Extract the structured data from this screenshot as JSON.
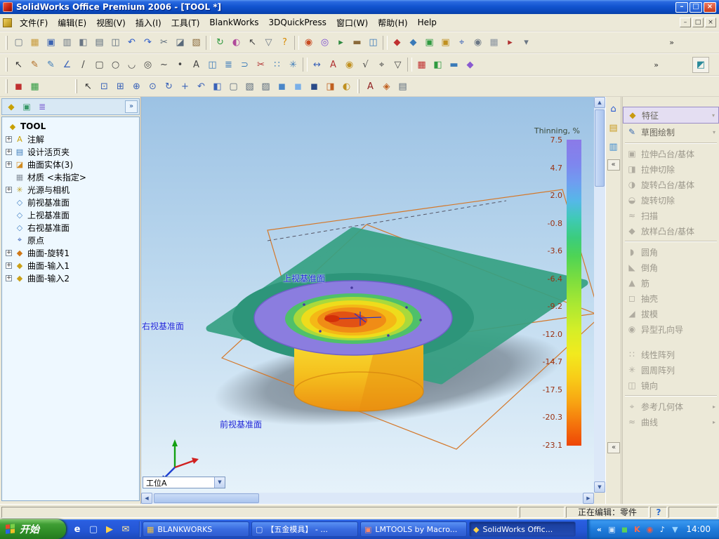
{
  "window": {
    "title": "SolidWorks Office Premium 2006 - [TOOL *]"
  },
  "glyphs": {
    "minimize": "–",
    "maximize": "□",
    "close": "×",
    "overflow": "»",
    "collapse": "«",
    "dropdown": "▼",
    "scroll_up": "▲",
    "scroll_down": "▼",
    "scroll_left": "◀",
    "scroll_right": "▶",
    "expand": "»"
  },
  "menu": {
    "items": [
      "文件(F)",
      "编辑(E)",
      "视图(V)",
      "插入(I)",
      "工具(T)",
      "BlankWorks",
      "3DQuickPress",
      "窗口(W)",
      "帮助(H)",
      "Help"
    ]
  },
  "toolbars": {
    "standard": [
      {
        "n": "new-document-icon",
        "g": "▢",
        "c": "#6a7684"
      },
      {
        "n": "open-icon",
        "g": "▦",
        "c": "#c89a3a"
      },
      {
        "n": "save-icon",
        "g": "▣",
        "c": "#3a62b0"
      },
      {
        "n": "make-drawing-icon",
        "g": "▥",
        "c": "#6a7684"
      },
      {
        "n": "make-assembly-icon",
        "g": "◧",
        "c": "#6a7684"
      },
      {
        "n": "print-icon",
        "g": "▤",
        "c": "#5a6a7a"
      },
      {
        "n": "print-preview-icon",
        "g": "◫",
        "c": "#5a6a7a"
      },
      {
        "n": "undo-icon",
        "g": "↶",
        "c": "#2a5ac8"
      },
      {
        "n": "redo-icon",
        "g": "↷",
        "c": "#2a5ac8"
      },
      {
        "n": "cut-icon",
        "g": "✂",
        "c": "#5a6a7a"
      },
      {
        "n": "copy-icon",
        "g": "◪",
        "c": "#5a6a7a"
      },
      {
        "n": "paste-icon",
        "g": "▧",
        "c": "#8a6a3a"
      },
      {
        "n": "toolbar-separator",
        "cls": "sep"
      },
      {
        "n": "rebuild-icon",
        "g": "↻",
        "c": "#2f9a40"
      },
      {
        "n": "edit-color-icon",
        "g": "◐",
        "c": "#b04a9a"
      },
      {
        "n": "select-tool-icon",
        "g": "↖",
        "c": "#444444"
      },
      {
        "n": "selection-filter-icon",
        "g": "▽",
        "c": "#6a7684"
      },
      {
        "n": "help-icon",
        "g": "?",
        "c": "#d88a00"
      },
      {
        "n": "toolbar-separator",
        "cls": "sep"
      },
      {
        "n": "edrawings-publish-icon",
        "g": "◉",
        "c": "#c84a20"
      },
      {
        "n": "photoworks-icon",
        "g": "◎",
        "c": "#7a4ad0"
      },
      {
        "n": "animator-icon",
        "g": "▸",
        "c": "#2f8a40"
      },
      {
        "n": "toolbox-icon",
        "g": "▬",
        "c": "#8a6a3a"
      },
      {
        "n": "pdmworks-icon",
        "g": "◫",
        "c": "#3a7ab8"
      },
      {
        "n": "toolbar-separator",
        "cls": "sep"
      },
      {
        "n": "3dquickpress-tool-icon",
        "g": "◆",
        "c": "#c03030"
      },
      {
        "n": "3dquickpress-strip-icon",
        "g": "◆",
        "c": "#3a7ab8"
      },
      {
        "n": "blankworks-unfold-icon",
        "g": "▣",
        "c": "#2f9a40"
      },
      {
        "n": "blankworks-blank-icon",
        "g": "▣",
        "c": "#c09020"
      },
      {
        "n": "measure-icon",
        "g": "⌖",
        "c": "#3a62b8"
      },
      {
        "n": "mass-properties-icon",
        "g": "◉",
        "c": "#6a7684"
      },
      {
        "n": "options-icon",
        "g": "▦",
        "c": "#8a94a0"
      },
      {
        "n": "macro-icon",
        "g": "▸",
        "c": "#b03030"
      },
      {
        "n": "customize-icon",
        "g": "▾",
        "c": "#6a7684"
      }
    ],
    "sketch": [
      {
        "n": "select-icon",
        "g": "↖",
        "c": "#333333"
      },
      {
        "n": "sketch-icon",
        "g": "✎",
        "c": "#b06a20"
      },
      {
        "n": "3d-sketch-icon",
        "g": "✎",
        "c": "#3a7ab8"
      },
      {
        "n": "smart-dimension-icon",
        "g": "∠",
        "c": "#3a62b8"
      },
      {
        "n": "line-icon",
        "g": "/",
        "c": "#444444"
      },
      {
        "n": "rectangle-icon",
        "g": "▢",
        "c": "#444444"
      },
      {
        "n": "circle-icon",
        "g": "○",
        "c": "#444444"
      },
      {
        "n": "arc-icon",
        "g": "◡",
        "c": "#444444"
      },
      {
        "n": "ellipse-icon",
        "g": "◎",
        "c": "#444444"
      },
      {
        "n": "spline-icon",
        "g": "~",
        "c": "#444444"
      },
      {
        "n": "point-icon",
        "g": "•",
        "c": "#444444"
      },
      {
        "n": "sketch-text-icon",
        "g": "A",
        "c": "#444444"
      },
      {
        "n": "mirror-entities-icon",
        "g": "◫",
        "c": "#3a7ab8"
      },
      {
        "n": "offset-entities-icon",
        "g": "≣",
        "c": "#3a7ab8"
      },
      {
        "n": "convert-entities-icon",
        "g": "⊃",
        "c": "#3a7ab8"
      },
      {
        "n": "trim-entities-icon",
        "g": "✂",
        "c": "#b03030"
      },
      {
        "n": "linear-sketch-pattern-icon",
        "g": "∷",
        "c": "#3a7ab8"
      },
      {
        "n": "circular-sketch-pattern-icon",
        "g": "✳",
        "c": "#3a7ab8"
      },
      {
        "n": "toolbar-separator",
        "cls": "sep"
      },
      {
        "n": "dimension-icon",
        "g": "↔",
        "c": "#3a62b8"
      },
      {
        "n": "note-icon",
        "g": "A",
        "c": "#b03030"
      },
      {
        "n": "balloon-icon",
        "g": "◉",
        "c": "#c09020"
      },
      {
        "n": "surface-finish-icon",
        "g": "√",
        "c": "#444444"
      },
      {
        "n": "geometric-tolerance-icon",
        "g": "⌖",
        "c": "#444444"
      },
      {
        "n": "datum-feature-icon",
        "g": "▽",
        "c": "#444444"
      },
      {
        "n": "toolbar-separator",
        "cls": "sep"
      },
      {
        "n": "blankworks-thinning-icon",
        "g": "▦",
        "c": "#c03030"
      },
      {
        "n": "blankworks-setup-icon",
        "g": "◧",
        "c": "#2f9a40"
      },
      {
        "n": "quickpress-strip-layout-icon",
        "g": "▬",
        "c": "#3a7ab8"
      },
      {
        "n": "quickpress-die-set-icon",
        "g": "◆",
        "c": "#8a5ad0"
      }
    ],
    "mini": [
      {
        "n": "result-plot-icon",
        "g": "◼",
        "c": "#c03030"
      },
      {
        "n": "mesh-display-icon",
        "g": "▦",
        "c": "#2f9a40"
      }
    ],
    "view": [
      {
        "n": "select-arrow-icon",
        "g": "↖",
        "c": "#333333"
      },
      {
        "n": "zoom-to-fit-icon",
        "g": "⊡",
        "c": "#3a62b8"
      },
      {
        "n": "zoom-to-area-icon",
        "g": "⊞",
        "c": "#3a62b8"
      },
      {
        "n": "zoom-in-out-icon",
        "g": "⊕",
        "c": "#3a62b8"
      },
      {
        "n": "zoom-to-selection-icon",
        "g": "⊙",
        "c": "#3a62b8"
      },
      {
        "n": "rotate-view-icon",
        "g": "↻",
        "c": "#3a62b8"
      },
      {
        "n": "pan-icon",
        "g": "+",
        "c": "#3a62b8"
      },
      {
        "n": "previous-view-icon",
        "g": "↶",
        "c": "#3a62b8"
      },
      {
        "n": "standard-views-icon",
        "g": "◧",
        "c": "#3a62b8"
      },
      {
        "n": "wireframe-icon",
        "g": "▢",
        "c": "#5a6a7a"
      },
      {
        "n": "hidden-lines-visible-icon",
        "g": "▧",
        "c": "#5a6a7a"
      },
      {
        "n": "hidden-lines-removed-icon",
        "g": "▨",
        "c": "#5a6a7a"
      },
      {
        "n": "shaded-with-edges-icon",
        "g": "◼",
        "c": "#4a86c8"
      },
      {
        "n": "shaded-icon",
        "g": "◼",
        "c": "#7ab0e8"
      },
      {
        "n": "shadows-icon",
        "g": "◼",
        "c": "#2a4a88"
      },
      {
        "n": "section-view-icon",
        "g": "◨",
        "c": "#c06020"
      },
      {
        "n": "realview-icon",
        "g": "◐",
        "c": "#c09020"
      }
    ],
    "extra": [
      {
        "n": "compare-results-icon",
        "g": "A",
        "c": "#902020"
      },
      {
        "n": "thickness-analysis-icon",
        "g": "◈",
        "c": "#c06020"
      },
      {
        "n": "analysis-report-icon",
        "g": "▤",
        "c": "#5a6a7a"
      }
    ],
    "float": {
      "g": "◩",
      "c": "#2a8a9a"
    }
  },
  "panel_tabs": [
    {
      "n": "featuremanager-tab-icon",
      "g": "◆",
      "c": "#c8a000"
    },
    {
      "n": "propertymanager-tab-icon",
      "g": "▣",
      "c": "#3a9a6a"
    },
    {
      "n": "configurationmanager-tab-icon",
      "g": "≣",
      "c": "#7a5ad0"
    }
  ],
  "feature_tree": {
    "root": "TOOL",
    "root_icon": "◆",
    "items": [
      {
        "plus": "+",
        "g": "A",
        "c": "#caa002",
        "label": "注解"
      },
      {
        "plus": "+",
        "g": "▤",
        "c": "#3a7ab8",
        "label": "设计活页夹"
      },
      {
        "plus": "+",
        "g": "◪",
        "c": "#d08a20",
        "label": "曲面实体(3)"
      },
      {
        "plus": "",
        "g": "▦",
        "c": "#8a94a0",
        "label": "材质 <未指定>"
      },
      {
        "plus": "+",
        "g": "✳",
        "c": "#c0a020",
        "label": "光源与相机"
      },
      {
        "plus": "",
        "g": "◇",
        "c": "#4a86c8",
        "label": "前视基准面"
      },
      {
        "plus": "",
        "g": "◇",
        "c": "#4a86c8",
        "label": "上视基准面"
      },
      {
        "plus": "",
        "g": "◇",
        "c": "#4a86c8",
        "label": "右视基准面"
      },
      {
        "plus": "",
        "g": "⌖",
        "c": "#3a62b8",
        "label": "原点"
      },
      {
        "plus": "+",
        "g": "◆",
        "c": "#d07818",
        "label": "曲面-旋转1"
      },
      {
        "plus": "+",
        "g": "◆",
        "c": "#caa018",
        "label": "曲面-输入1"
      },
      {
        "plus": "+",
        "g": "◆",
        "c": "#caa018",
        "label": "曲面-输入2"
      }
    ]
  },
  "viewport": {
    "labels": {
      "top": "上视基准面",
      "left": "右视基准面",
      "bottom": "前视基准面"
    },
    "combo_value": "工位A",
    "legend": {
      "title": "Thinning, %",
      "values": [
        "7.5",
        "4.7",
        "2.0",
        "-0.8",
        "-3.6",
        "-6.4",
        "-9.2",
        "-12.0",
        "-14.7",
        "-17.5",
        "-20.3",
        "-23.1"
      ]
    }
  },
  "side_strip": {
    "icons": [
      {
        "n": "home-icon",
        "g": "⌂",
        "c": "#2a5ad0"
      },
      {
        "n": "design-library-icon",
        "g": "▤",
        "c": "#c89a20"
      },
      {
        "n": "file-explorer-icon",
        "g": "▥",
        "c": "#3a8ad0"
      }
    ]
  },
  "task_pane": {
    "headers": [
      {
        "n": "features-header",
        "g": "◆",
        "c": "#c89a10",
        "label": "特征",
        "arrow": "▾",
        "cls": "hl"
      },
      {
        "n": "sketch-header",
        "g": "✎",
        "c": "#3a6ab0",
        "label": "草图绘制",
        "arrow": "▾"
      }
    ],
    "group1": [
      {
        "n": "extruded-boss-base",
        "g": "▣",
        "label": "拉伸凸台/基体"
      },
      {
        "n": "extruded-cut",
        "g": "◨",
        "label": "拉伸切除"
      },
      {
        "n": "revolved-boss-base",
        "g": "◑",
        "label": "旋转凸台/基体"
      },
      {
        "n": "revolved-cut",
        "g": "◒",
        "label": "旋转切除"
      },
      {
        "n": "sweep",
        "g": "≈",
        "label": "扫描"
      },
      {
        "n": "loft-boss-base",
        "g": "◆",
        "label": "放样凸台/基体"
      }
    ],
    "group2": [
      {
        "n": "fillet",
        "g": "◗",
        "label": "圆角"
      },
      {
        "n": "chamfer",
        "g": "◣",
        "label": "倒角"
      },
      {
        "n": "rib",
        "g": "▲",
        "label": "筋"
      },
      {
        "n": "shell",
        "g": "◻",
        "label": "抽壳"
      },
      {
        "n": "draft",
        "g": "◢",
        "label": "拔模"
      },
      {
        "n": "hole-wizard",
        "g": "◉",
        "label": "异型孔向导"
      }
    ],
    "group3": [
      {
        "n": "linear-pattern",
        "g": "∷",
        "label": "线性阵列"
      },
      {
        "n": "circular-pattern",
        "g": "✳",
        "label": "圆周阵列"
      },
      {
        "n": "mirror-feature",
        "g": "◫",
        "label": "镜向"
      }
    ],
    "group4": [
      {
        "n": "reference-geometry",
        "g": "⌖",
        "label": "参考几何体",
        "arrow": "▸"
      },
      {
        "n": "curves",
        "g": "≈",
        "label": "曲线",
        "arrow": "▸"
      }
    ]
  },
  "statusbar": {
    "editing": "正在编辑：零件",
    "help": "?"
  },
  "taskbar": {
    "start": "开始",
    "quick_launch": [
      {
        "n": "launch-browser-icon",
        "g": "e",
        "c": "#ffffff"
      },
      {
        "n": "launch-desktop-icon",
        "g": "▢",
        "c": "#d8e8ff"
      },
      {
        "n": "launch-media-icon",
        "g": "▶",
        "c": "#ffd24a"
      },
      {
        "n": "launch-mail-icon",
        "g": "✉",
        "c": "#ffe8a0"
      }
    ],
    "tasks": [
      {
        "g": "▦",
        "c": "#f0c040",
        "label": "BLANKWORKS"
      },
      {
        "g": "▢",
        "c": "#cfe0ff",
        "label": "【五金模具】 - ..."
      },
      {
        "g": "▣",
        "c": "#ff8866",
        "label": "LMTOOLS by Macro..."
      },
      {
        "g": "◆",
        "c": "#ffd24a",
        "label": "SolidWorks Offic...",
        "cls": "active"
      }
    ],
    "tray": {
      "icons": [
        {
          "n": "tray-hide-icon",
          "g": "«",
          "c": "#ffffff"
        },
        {
          "n": "tray-display-icon",
          "g": "▣",
          "c": "#cde2f8"
        },
        {
          "n": "tray-safety-icon",
          "g": "◼",
          "c": "#5ad05a"
        },
        {
          "n": "tray-kingsoft-icon",
          "g": "K",
          "c": "#ff6a4a"
        },
        {
          "n": "tray-alert-icon",
          "g": "◉",
          "c": "#ff5a3a"
        },
        {
          "n": "tray-volume-icon",
          "g": "♪",
          "c": "#ffffff"
        },
        {
          "n": "tray-network-icon",
          "g": "▼",
          "c": "#9ad4ff"
        }
      ],
      "time": "14:00"
    }
  }
}
